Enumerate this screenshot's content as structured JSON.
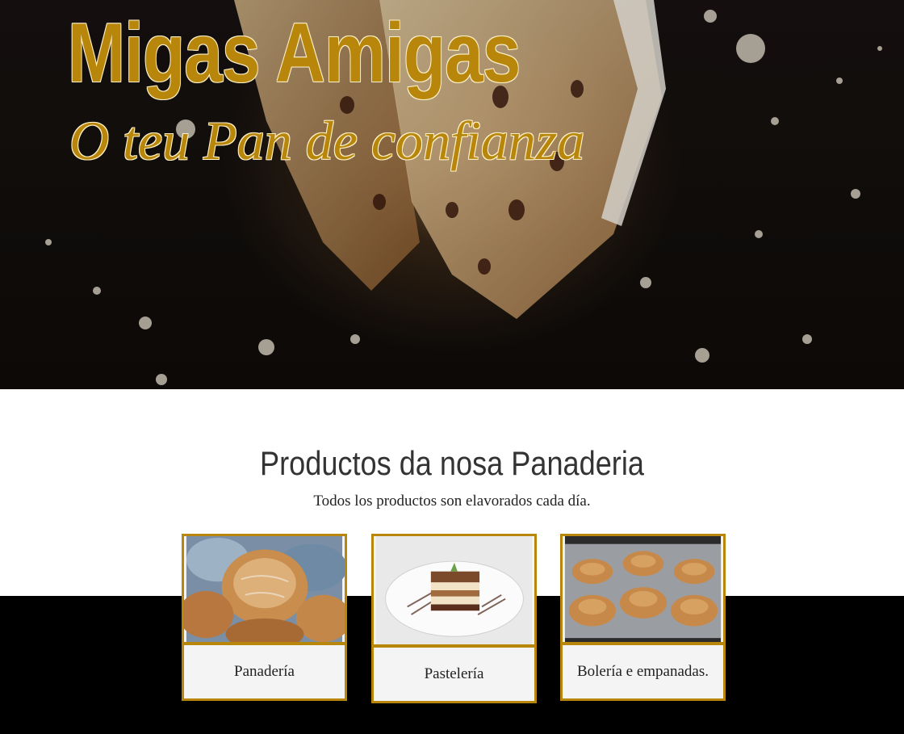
{
  "hero": {
    "title": "Migas Amigas",
    "subtitle": "O teu Pan de confianza"
  },
  "products": {
    "title": "Productos da nosa Panaderia",
    "subtitle": "Todos los productos son elavorados cada día.",
    "cards": [
      {
        "label": "Panadería",
        "image": "bread-loaves"
      },
      {
        "label": "Pastelería",
        "image": "layered-cake-slice"
      },
      {
        "label": "Bolería e empanadas.",
        "image": "muffins-tray"
      }
    ]
  },
  "colors": {
    "accent": "#b8860b",
    "band": "#000000",
    "card_bg": "#f4f4f4"
  }
}
